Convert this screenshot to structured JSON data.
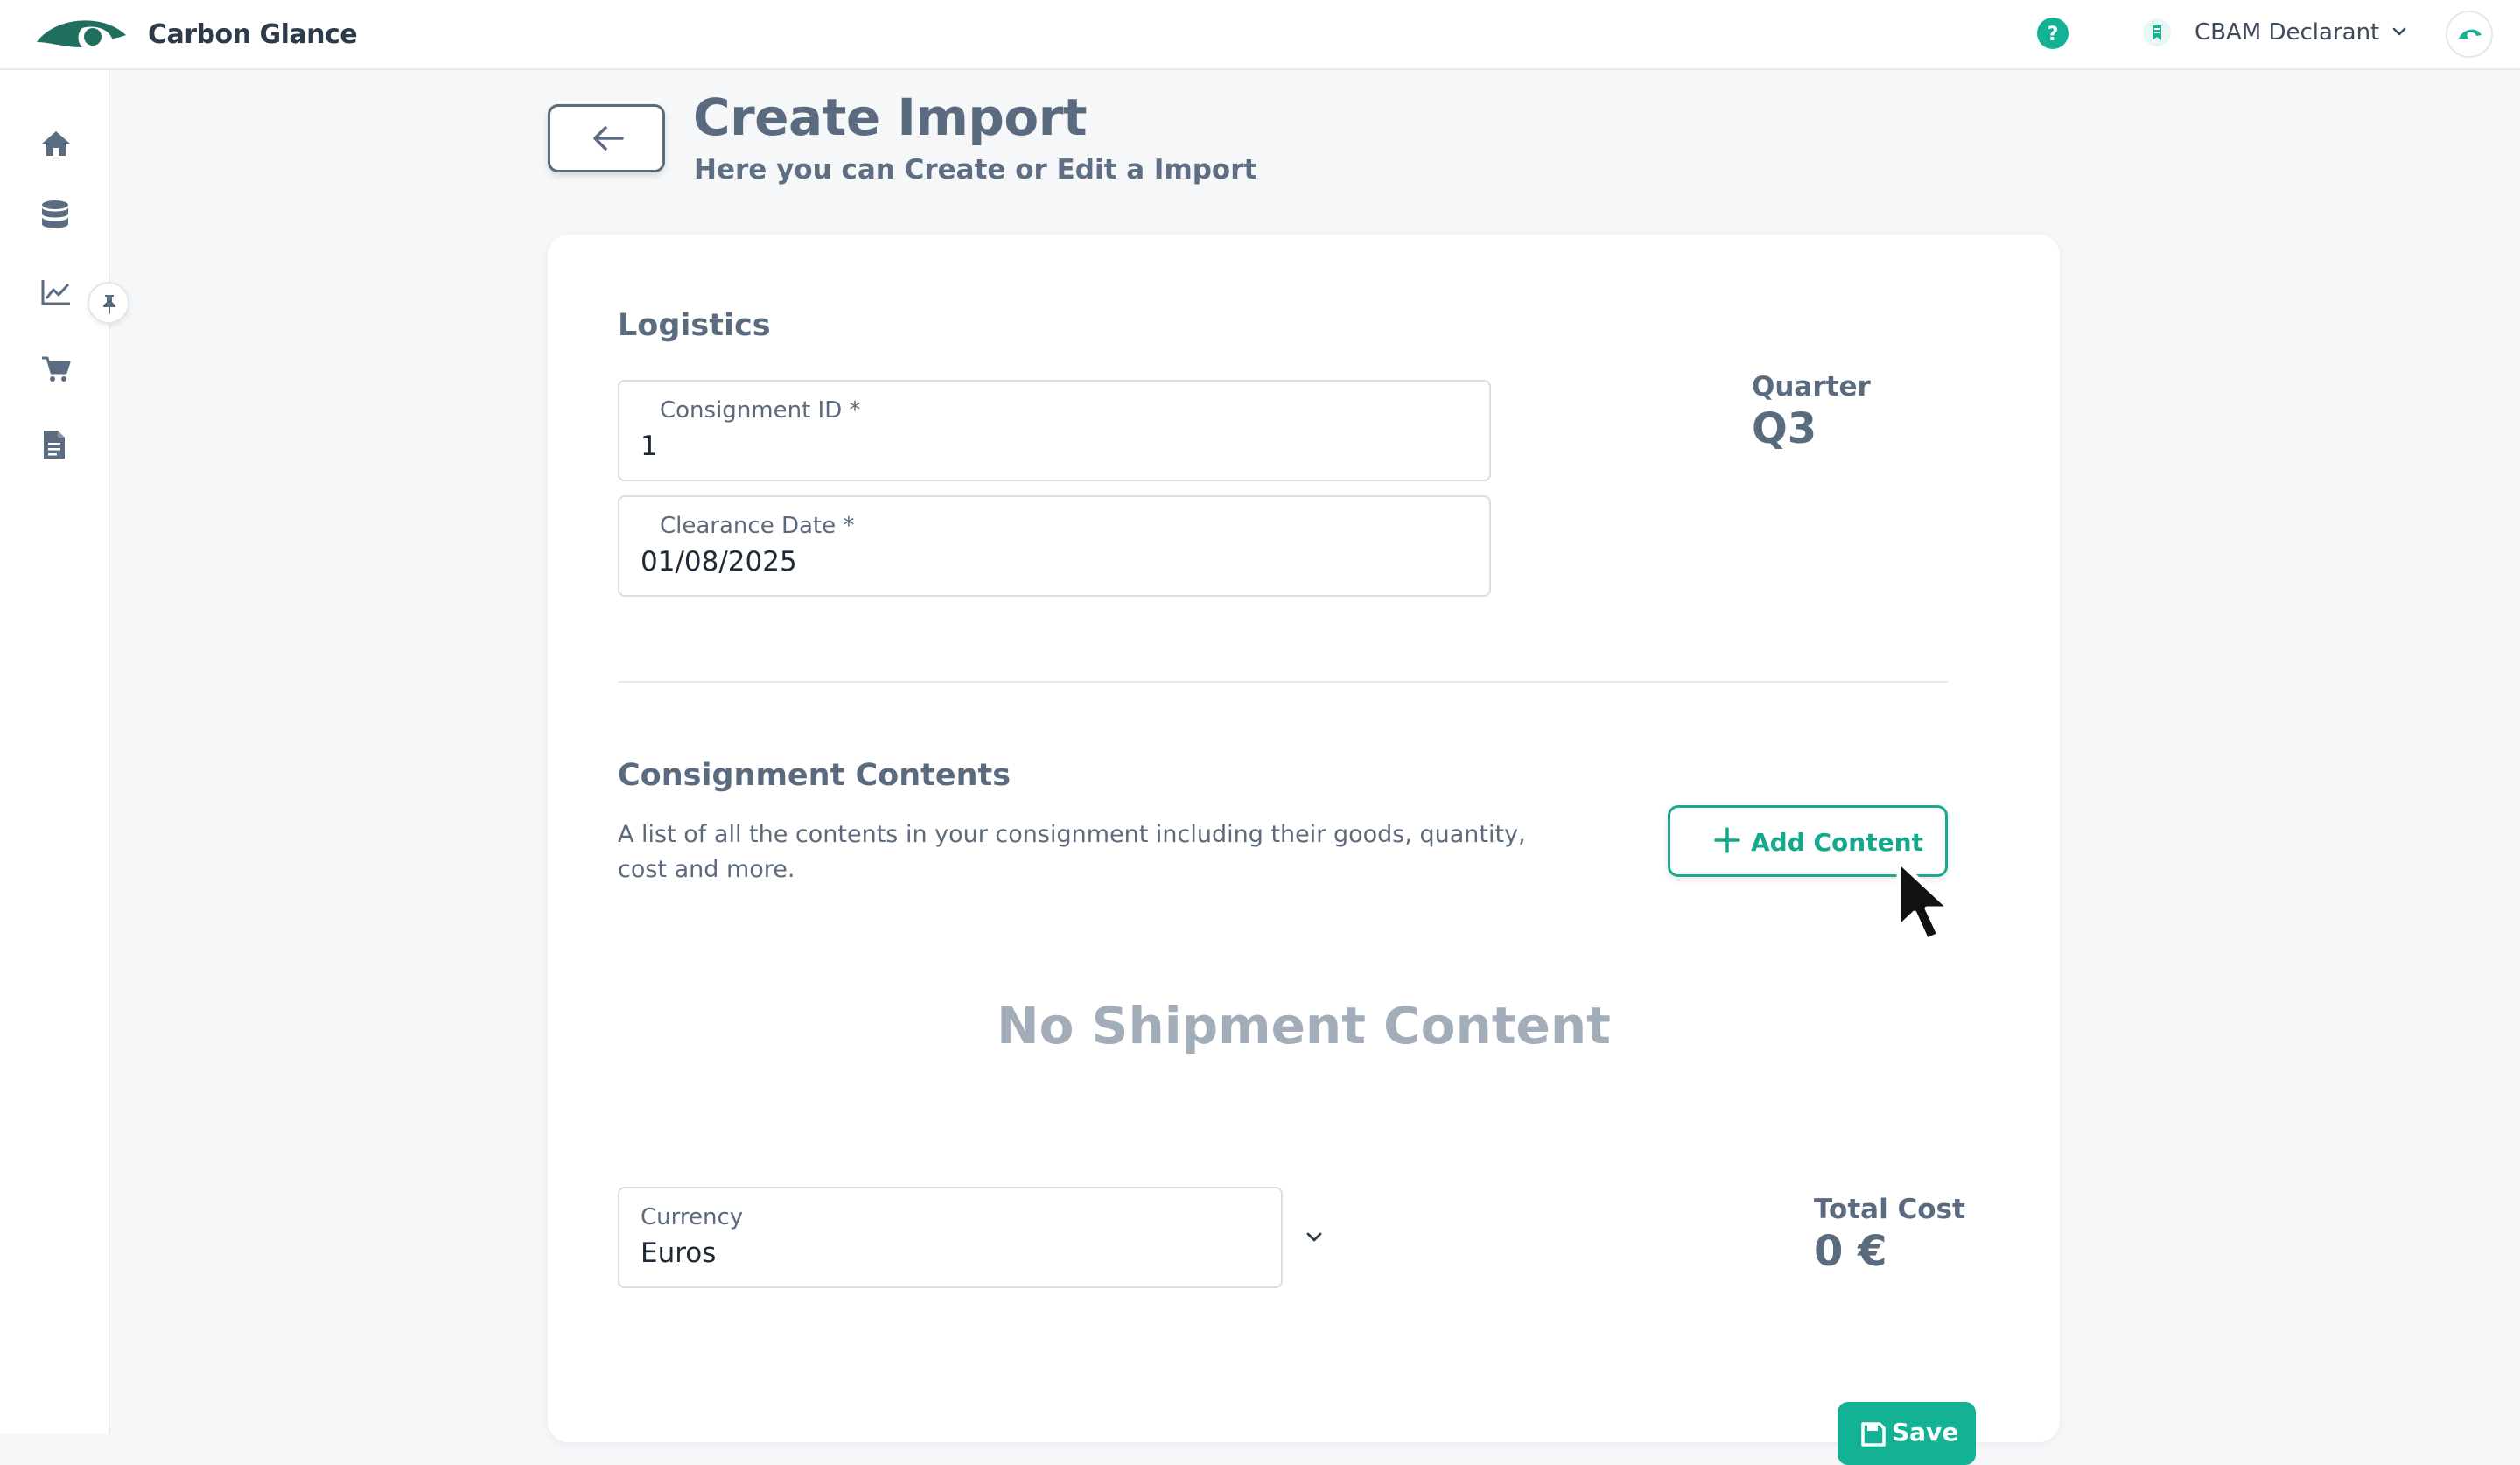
{
  "app": {
    "name": "Carbon Glance"
  },
  "header": {
    "role_label": "CBAM Declarant"
  },
  "sidebar": {
    "items": [
      {
        "icon": "home-icon"
      },
      {
        "icon": "database-icon"
      },
      {
        "icon": "chart-icon"
      },
      {
        "icon": "cart-icon"
      },
      {
        "icon": "document-icon"
      }
    ]
  },
  "page": {
    "title": "Create Import",
    "subtitle": "Here you can Create or Edit a Import"
  },
  "logistics": {
    "title": "Logistics",
    "consignment_id_label": "Consignment ID *",
    "consignment_id_value": "1",
    "clearance_date_label": "Clearance Date *",
    "clearance_date_value": "01/08/2025",
    "quarter_label": "Quarter",
    "quarter_value": "Q3"
  },
  "contents": {
    "title": "Consignment Contents",
    "description": "A list of all the contents in your consignment including their goods, quantity, cost and more.",
    "add_button_label": "Add Content",
    "empty_message": "No Shipment Content"
  },
  "currency": {
    "label": "Currency",
    "value": "Euros"
  },
  "total": {
    "label": "Total Cost",
    "value": "0 €"
  },
  "actions": {
    "save_label": "Save"
  },
  "colors": {
    "accent": "#14b294",
    "text": "#5a6b80",
    "logo": "#1f6e5e"
  }
}
